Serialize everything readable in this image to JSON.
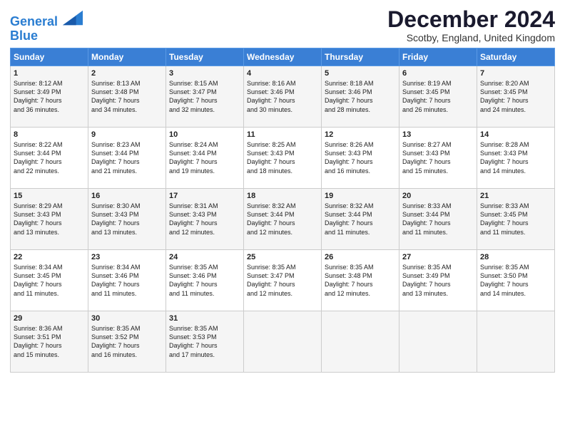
{
  "header": {
    "logo_line1": "General",
    "logo_line2": "Blue",
    "month": "December 2024",
    "location": "Scotby, England, United Kingdom"
  },
  "days_of_week": [
    "Sunday",
    "Monday",
    "Tuesday",
    "Wednesday",
    "Thursday",
    "Friday",
    "Saturday"
  ],
  "weeks": [
    [
      {
        "day": "1",
        "info": "Sunrise: 8:12 AM\nSunset: 3:49 PM\nDaylight: 7 hours\nand 36 minutes."
      },
      {
        "day": "2",
        "info": "Sunrise: 8:13 AM\nSunset: 3:48 PM\nDaylight: 7 hours\nand 34 minutes."
      },
      {
        "day": "3",
        "info": "Sunrise: 8:15 AM\nSunset: 3:47 PM\nDaylight: 7 hours\nand 32 minutes."
      },
      {
        "day": "4",
        "info": "Sunrise: 8:16 AM\nSunset: 3:46 PM\nDaylight: 7 hours\nand 30 minutes."
      },
      {
        "day": "5",
        "info": "Sunrise: 8:18 AM\nSunset: 3:46 PM\nDaylight: 7 hours\nand 28 minutes."
      },
      {
        "day": "6",
        "info": "Sunrise: 8:19 AM\nSunset: 3:45 PM\nDaylight: 7 hours\nand 26 minutes."
      },
      {
        "day": "7",
        "info": "Sunrise: 8:20 AM\nSunset: 3:45 PM\nDaylight: 7 hours\nand 24 minutes."
      }
    ],
    [
      {
        "day": "8",
        "info": "Sunrise: 8:22 AM\nSunset: 3:44 PM\nDaylight: 7 hours\nand 22 minutes."
      },
      {
        "day": "9",
        "info": "Sunrise: 8:23 AM\nSunset: 3:44 PM\nDaylight: 7 hours\nand 21 minutes."
      },
      {
        "day": "10",
        "info": "Sunrise: 8:24 AM\nSunset: 3:44 PM\nDaylight: 7 hours\nand 19 minutes."
      },
      {
        "day": "11",
        "info": "Sunrise: 8:25 AM\nSunset: 3:43 PM\nDaylight: 7 hours\nand 18 minutes."
      },
      {
        "day": "12",
        "info": "Sunrise: 8:26 AM\nSunset: 3:43 PM\nDaylight: 7 hours\nand 16 minutes."
      },
      {
        "day": "13",
        "info": "Sunrise: 8:27 AM\nSunset: 3:43 PM\nDaylight: 7 hours\nand 15 minutes."
      },
      {
        "day": "14",
        "info": "Sunrise: 8:28 AM\nSunset: 3:43 PM\nDaylight: 7 hours\nand 14 minutes."
      }
    ],
    [
      {
        "day": "15",
        "info": "Sunrise: 8:29 AM\nSunset: 3:43 PM\nDaylight: 7 hours\nand 13 minutes."
      },
      {
        "day": "16",
        "info": "Sunrise: 8:30 AM\nSunset: 3:43 PM\nDaylight: 7 hours\nand 13 minutes."
      },
      {
        "day": "17",
        "info": "Sunrise: 8:31 AM\nSunset: 3:43 PM\nDaylight: 7 hours\nand 12 minutes."
      },
      {
        "day": "18",
        "info": "Sunrise: 8:32 AM\nSunset: 3:44 PM\nDaylight: 7 hours\nand 12 minutes."
      },
      {
        "day": "19",
        "info": "Sunrise: 8:32 AM\nSunset: 3:44 PM\nDaylight: 7 hours\nand 11 minutes."
      },
      {
        "day": "20",
        "info": "Sunrise: 8:33 AM\nSunset: 3:44 PM\nDaylight: 7 hours\nand 11 minutes."
      },
      {
        "day": "21",
        "info": "Sunrise: 8:33 AM\nSunset: 3:45 PM\nDaylight: 7 hours\nand 11 minutes."
      }
    ],
    [
      {
        "day": "22",
        "info": "Sunrise: 8:34 AM\nSunset: 3:45 PM\nDaylight: 7 hours\nand 11 minutes."
      },
      {
        "day": "23",
        "info": "Sunrise: 8:34 AM\nSunset: 3:46 PM\nDaylight: 7 hours\nand 11 minutes."
      },
      {
        "day": "24",
        "info": "Sunrise: 8:35 AM\nSunset: 3:46 PM\nDaylight: 7 hours\nand 11 minutes."
      },
      {
        "day": "25",
        "info": "Sunrise: 8:35 AM\nSunset: 3:47 PM\nDaylight: 7 hours\nand 12 minutes."
      },
      {
        "day": "26",
        "info": "Sunrise: 8:35 AM\nSunset: 3:48 PM\nDaylight: 7 hours\nand 12 minutes."
      },
      {
        "day": "27",
        "info": "Sunrise: 8:35 AM\nSunset: 3:49 PM\nDaylight: 7 hours\nand 13 minutes."
      },
      {
        "day": "28",
        "info": "Sunrise: 8:35 AM\nSunset: 3:50 PM\nDaylight: 7 hours\nand 14 minutes."
      }
    ],
    [
      {
        "day": "29",
        "info": "Sunrise: 8:36 AM\nSunset: 3:51 PM\nDaylight: 7 hours\nand 15 minutes."
      },
      {
        "day": "30",
        "info": "Sunrise: 8:35 AM\nSunset: 3:52 PM\nDaylight: 7 hours\nand 16 minutes."
      },
      {
        "day": "31",
        "info": "Sunrise: 8:35 AM\nSunset: 3:53 PM\nDaylight: 7 hours\nand 17 minutes."
      },
      {
        "day": "",
        "info": ""
      },
      {
        "day": "",
        "info": ""
      },
      {
        "day": "",
        "info": ""
      },
      {
        "day": "",
        "info": ""
      }
    ]
  ]
}
